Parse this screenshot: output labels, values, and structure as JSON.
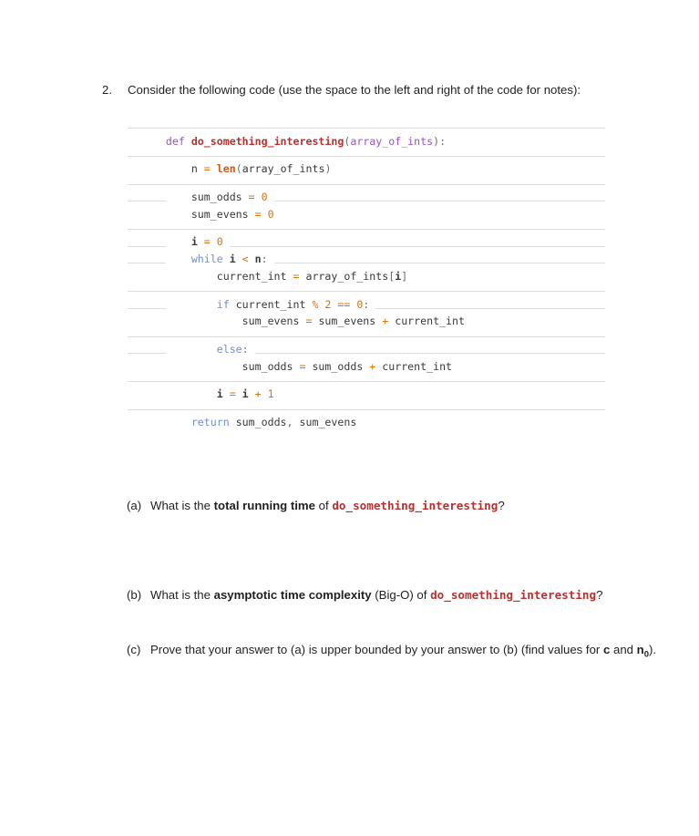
{
  "question": {
    "number": "2.",
    "prompt": "Consider the following code (use the space to the left and right of the code for notes):"
  },
  "code": {
    "language": "python",
    "function_name": "do_something_interesting",
    "lines": [
      {
        "indent": 0,
        "text": "def do_something_interesting(array_of_ints):",
        "has_rule": true
      },
      {
        "indent": 0,
        "text": "",
        "has_rule": false
      },
      {
        "indent": 1,
        "text": "n = len(array_of_ints)",
        "has_rule": true
      },
      {
        "indent": 0,
        "text": "",
        "has_rule": false
      },
      {
        "indent": 1,
        "text": "sum_odds = 0",
        "has_rule": true
      },
      {
        "indent": 1,
        "text": "sum_evens = 0",
        "has_rule": true
      },
      {
        "indent": 0,
        "text": "",
        "has_rule": false
      },
      {
        "indent": 1,
        "text": "i = 0",
        "has_rule": true
      },
      {
        "indent": 1,
        "text": "while i < n:",
        "has_rule": true
      },
      {
        "indent": 2,
        "text": "current_int = array_of_ints[i]",
        "has_rule": true
      },
      {
        "indent": 0,
        "text": "",
        "has_rule": false
      },
      {
        "indent": 2,
        "text": "if current_int % 2 == 0:",
        "has_rule": true
      },
      {
        "indent": 3,
        "text": "sum_evens = sum_evens + current_int",
        "has_rule": true
      },
      {
        "indent": 0,
        "text": "",
        "has_rule": false
      },
      {
        "indent": 2,
        "text": "else:",
        "has_rule": true
      },
      {
        "indent": 3,
        "text": "sum_odds = sum_odds + current_int",
        "has_rule": true
      },
      {
        "indent": 0,
        "text": "",
        "has_rule": false
      },
      {
        "indent": 2,
        "text": "i = i + 1",
        "has_rule": true
      },
      {
        "indent": 0,
        "text": "",
        "has_rule": false
      },
      {
        "indent": 1,
        "text": "return sum_odds, sum_evens",
        "has_rule": true
      }
    ]
  },
  "subquestions": [
    {
      "label": "(a)",
      "text_1": "What is the ",
      "bold_1": "total running time",
      "text_2": " of ",
      "code_ref": "do_something_interesting",
      "text_3": "?"
    },
    {
      "label": "(b)",
      "text_1": "What is the ",
      "bold_1": "asymptotic time complexity",
      "text_2": " (Big-O) of ",
      "code_ref": "do_something_interesting",
      "text_3": "?"
    },
    {
      "label": "(c)",
      "text_1": "Prove that your answer to (a) is upper bounded by your answer to (b) (find values for ",
      "bold_1": "c",
      "text_2": " and ",
      "bold_2": "n",
      "bold_2_sub": "0",
      "text_3": ")."
    }
  ],
  "colors": {
    "keyword": "#6d8fd4",
    "def_keyword": "#9b51c9",
    "function_name": "#b8312f",
    "parameter": "#9b51c9",
    "builtin": "#d9540a",
    "number": "#d9710a",
    "operator": "#d9710a",
    "identifier": "#3a3a3a",
    "rule_line": "#dcdcdc",
    "body_text": "#231f20",
    "page_background": "#ffffff"
  }
}
